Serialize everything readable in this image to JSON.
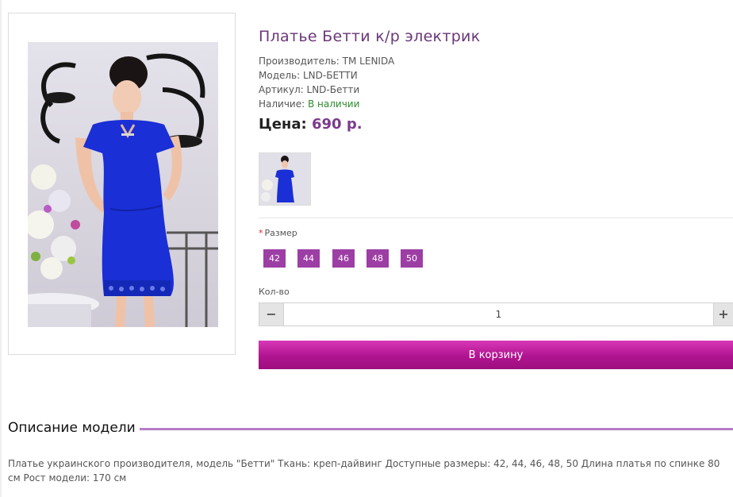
{
  "product": {
    "title": "Платье Бетти к/р электрик",
    "manufacturer_label": "Производитель:",
    "manufacturer_value": "TM LENIDA",
    "model_label": "Модель:",
    "model_value": "LND-БЕТТИ",
    "sku_label": "Артикул:",
    "sku_value": "LND-Бетти",
    "availability_label": "Наличие:",
    "availability_value": "В наличии",
    "price_label": "Цена:",
    "price_value": "690 р."
  },
  "options": {
    "required_mark": "*",
    "size_label": "Размер",
    "sizes": [
      "42",
      "44",
      "46",
      "48",
      "50"
    ]
  },
  "quantity": {
    "label": "Кол-во",
    "minus": "−",
    "plus": "+",
    "value": "1"
  },
  "cart": {
    "button_label": "В корзину"
  },
  "description": {
    "title": "Описание модели",
    "text": "Платье украинского производителя, модель \"Бетти\" Ткань: креп-дайвинг Доступные размеры: 42, 44, 46, 48, 50 Длина платья по спинке 80 см Рост модели: 170 см"
  },
  "colors": {
    "accent": "#9d3ea5",
    "title": "#6a3778",
    "price": "#7b3a8a",
    "cart_button": "#b0148f",
    "in_stock": "#2e8b2e",
    "dress": "#1a2fd6"
  }
}
